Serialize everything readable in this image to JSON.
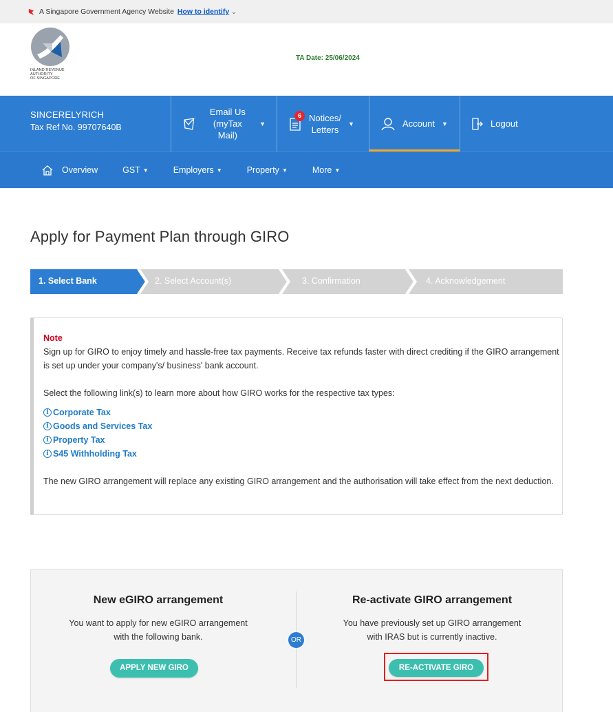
{
  "masthead": {
    "agency_text": "A Singapore Government Agency Website",
    "identify_link": "How to identify"
  },
  "logo": {
    "org_line1": "INLAND REVENUE",
    "org_line2": "AUTHORITY",
    "org_line3": "OF SINGAPORE"
  },
  "ta_date": "TA Date: 25/06/2024",
  "user": {
    "name": "SINCERELYRICH",
    "tax_ref": "Tax Ref No. 99707640B"
  },
  "topnav": {
    "email_line1": "Email Us",
    "email_line2": "(myTax Mail)",
    "notices_line1": "Notices/",
    "notices_line2": "Letters",
    "notices_badge": "6",
    "account": "Account",
    "logout": "Logout"
  },
  "subnav": {
    "overview": "Overview",
    "gst": "GST",
    "employers": "Employers",
    "property": "Property",
    "more": "More"
  },
  "page_title": "Apply for Payment Plan through GIRO",
  "steps": [
    {
      "label": "1. Select Bank",
      "active": true
    },
    {
      "label": "2. Select Account(s)",
      "active": false
    },
    {
      "label": "3. Confirmation",
      "active": false
    },
    {
      "label": "4. Acknowledgement",
      "active": false
    }
  ],
  "note": {
    "title": "Note",
    "para1": "Sign up for GIRO to enjoy timely and hassle-free tax payments. Receive tax refunds faster with direct crediting if the GIRO arrangement is set up under your company's/ business' bank account.",
    "para2": "Select the following link(s) to learn more about how GIRO works for the respective tax types:",
    "links": [
      "Corporate Tax",
      "Goods and Services Tax",
      "Property Tax",
      "S45 Withholding Tax"
    ],
    "para3": "The new GIRO arrangement will replace any existing GIRO arrangement and the authorisation will take effect from the next deduction."
  },
  "options": {
    "left": {
      "heading": "New eGIRO arrangement",
      "desc_line1": "You want to apply for new eGIRO arrangement",
      "desc_line2": "with the following bank.",
      "button": "APPLY NEW GIRO"
    },
    "or": "OR",
    "right": {
      "heading": "Re-activate GIRO arrangement",
      "desc_line1": "You have previously set up GIRO arrangement",
      "desc_line2": "with IRAS but is currently inactive.",
      "button": "RE-ACTIVATE GIRO"
    }
  },
  "colors": {
    "nav_blue": "#2d7dd2",
    "step_active": "#2d7dd2",
    "step_inactive": "#d3d3d3",
    "teal_button": "#3cbfae",
    "note_red": "#d0021b",
    "link_blue": "#1f7bc8",
    "highlight_red": "#e02020"
  }
}
